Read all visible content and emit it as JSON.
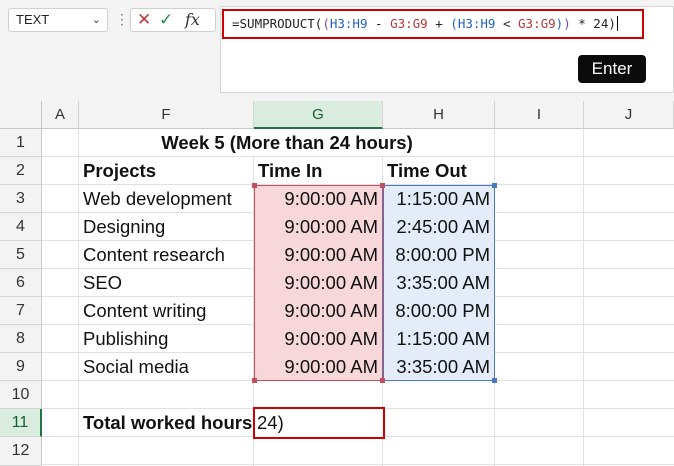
{
  "name_box": {
    "value": "TEXT",
    "dropdown_icon": "chevron-down-icon"
  },
  "formula_bar": {
    "icons": [
      "more-icon",
      "cancel-icon",
      "confirm-icon",
      "function-icon"
    ],
    "cancel_glyph": "✕",
    "confirm_glyph": "✓",
    "fx_glyph": "fx",
    "more_glyph": "⋮",
    "tokens": [
      {
        "text": "=SUMPRODUCT(",
        "color": "#222222"
      },
      {
        "text": "(",
        "color": "#7a3fb0"
      },
      {
        "text": "H3:H9",
        "color": "#1f5fbf"
      },
      {
        "text": " - ",
        "color": "#222222"
      },
      {
        "text": "G3:G9",
        "color": "#b8363a"
      },
      {
        "text": " + ",
        "color": "#222222"
      },
      {
        "text": "(",
        "color": "#1f5fbf"
      },
      {
        "text": "H3:H9",
        "color": "#1f5fbf"
      },
      {
        "text": " < ",
        "color": "#222222"
      },
      {
        "text": "G3:G9",
        "color": "#b8363a"
      },
      {
        "text": ")",
        "color": "#1f5fbf"
      },
      {
        "text": ")",
        "color": "#7a3fb0"
      },
      {
        "text": " * 24)",
        "color": "#222222"
      }
    ]
  },
  "enter_button": {
    "label": "Enter"
  },
  "columns": [
    "A",
    "F",
    "G",
    "H",
    "I",
    "J"
  ],
  "rows": [
    "1",
    "2",
    "3",
    "4",
    "5",
    "6",
    "7",
    "8",
    "9",
    "10",
    "11",
    "12"
  ],
  "sheet": {
    "title": "Week 5 (More than 24 hours)",
    "headers": {
      "projects": "Projects",
      "time_in": "Time In",
      "time_out": "Time Out"
    },
    "data": [
      {
        "project": "Web development",
        "time_in": "9:00:00 AM",
        "time_out": "1:15:00 AM"
      },
      {
        "project": "Designing",
        "time_in": "9:00:00 AM",
        "time_out": "2:45:00 AM"
      },
      {
        "project": "Content research",
        "time_in": "9:00:00 AM",
        "time_out": "8:00:00 PM"
      },
      {
        "project": "SEO",
        "time_in": "9:00:00 AM",
        "time_out": "3:35:00 AM"
      },
      {
        "project": "Content writing",
        "time_in": "9:00:00 AM",
        "time_out": "8:00:00 PM"
      },
      {
        "project": "Publishing",
        "time_in": "9:00:00 AM",
        "time_out": "1:15:00 AM"
      },
      {
        "project": "Social media",
        "time_in": "9:00:00 AM",
        "time_out": "3:35:00 AM"
      }
    ],
    "total_label": "Total worked hours",
    "total_edit_value": "24)"
  },
  "colors": {
    "highlight_red": "#d00000",
    "range_g_fill": "#f7d7da",
    "range_h_fill": "#e3ecf8",
    "selected_header": "#217346"
  }
}
